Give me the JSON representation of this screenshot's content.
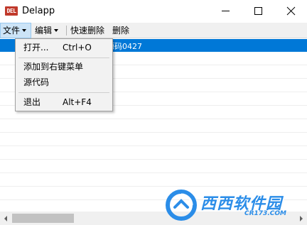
{
  "window": {
    "title": "Delapp",
    "app_icon_text": "DEL"
  },
  "menubar": {
    "file_label": "文件",
    "edit_label": "编辑",
    "quick_delete_label": "快速删除",
    "delete_label": "删除"
  },
  "file_menu": {
    "items": [
      {
        "label": "打开...",
        "shortcut": "Ctrl+O"
      },
      {
        "label": "添加到右键菜单",
        "shortcut": ""
      },
      {
        "label": "源代码",
        "shortcut": ""
      },
      {
        "label": "退出",
        "shortcut": "Alt+F4"
      }
    ]
  },
  "list": {
    "selected_row_text": "源码0427"
  },
  "watermark": {
    "brand": "西西软件园",
    "url": "CR173.COM"
  },
  "colors": {
    "selection": "#0078d7",
    "menu_highlight": "#cce4f7",
    "app_icon": "#c0392b",
    "watermark": "#2b8de8"
  },
  "icons": [
    "app-icon",
    "minimize-icon",
    "maximize-icon",
    "close-icon",
    "chevron-down-icon",
    "scroll-left-icon",
    "scroll-right-icon",
    "watermark-logo-icon"
  ]
}
